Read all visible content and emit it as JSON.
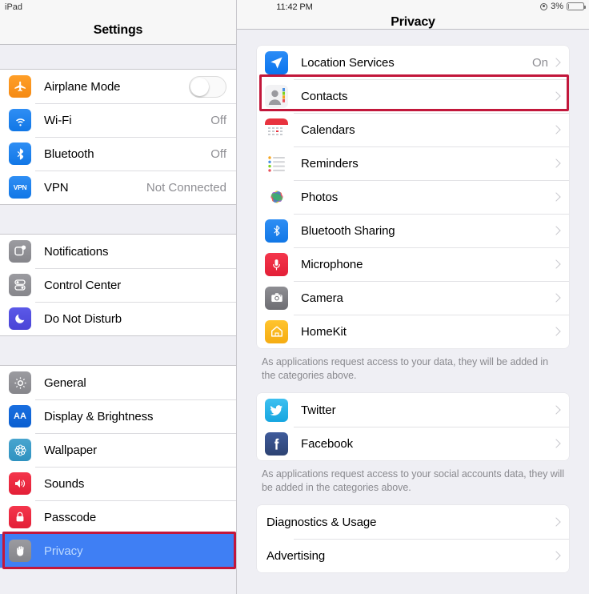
{
  "status_bar": {
    "device": "iPad",
    "time": "11:42 PM",
    "battery_percent": "3%",
    "location_icon": "location-lock-icon",
    "battery_icon": "battery-empty-icon"
  },
  "sidebar": {
    "title": "Settings",
    "groups": [
      {
        "items": [
          {
            "label": "Airplane Mode",
            "icon": "airplane-icon",
            "control": "toggle",
            "toggle_on": false,
            "value": ""
          },
          {
            "label": "Wi-Fi",
            "icon": "wifi-icon",
            "control": "value",
            "value": "Off"
          },
          {
            "label": "Bluetooth",
            "icon": "bluetooth-icon",
            "control": "value",
            "value": "Off"
          },
          {
            "label": "VPN",
            "icon": "vpn-icon",
            "control": "value",
            "value": "Not Connected"
          }
        ]
      },
      {
        "items": [
          {
            "label": "Notifications",
            "icon": "notifications-icon",
            "control": "none",
            "value": ""
          },
          {
            "label": "Control Center",
            "icon": "control-center-icon",
            "control": "none",
            "value": ""
          },
          {
            "label": "Do Not Disturb",
            "icon": "moon-icon",
            "control": "none",
            "value": ""
          }
        ]
      },
      {
        "items": [
          {
            "label": "General",
            "icon": "gear-icon",
            "control": "none",
            "value": ""
          },
          {
            "label": "Display & Brightness",
            "icon": "display-brightness-icon",
            "control": "none",
            "value": ""
          },
          {
            "label": "Wallpaper",
            "icon": "wallpaper-icon",
            "control": "none",
            "value": ""
          },
          {
            "label": "Sounds",
            "icon": "speaker-icon",
            "control": "none",
            "value": ""
          },
          {
            "label": "Passcode",
            "icon": "lock-icon",
            "control": "none",
            "value": ""
          },
          {
            "label": "Privacy",
            "icon": "hand-icon",
            "control": "none",
            "value": "",
            "selected": true
          }
        ]
      }
    ]
  },
  "detail": {
    "title": "Privacy",
    "card_one": [
      {
        "label": "Location Services",
        "icon": "location-arrow-icon",
        "value": "On",
        "highlighted": true
      },
      {
        "label": "Contacts",
        "icon": "contacts-icon",
        "value": ""
      },
      {
        "label": "Calendars",
        "icon": "calendar-icon",
        "value": ""
      },
      {
        "label": "Reminders",
        "icon": "reminders-icon",
        "value": ""
      },
      {
        "label": "Photos",
        "icon": "photos-icon",
        "value": ""
      },
      {
        "label": "Bluetooth Sharing",
        "icon": "bluetooth-icon",
        "value": ""
      },
      {
        "label": "Microphone",
        "icon": "microphone-icon",
        "value": ""
      },
      {
        "label": "Camera",
        "icon": "camera-icon",
        "value": ""
      },
      {
        "label": "HomeKit",
        "icon": "homekit-icon",
        "value": ""
      }
    ],
    "footnote_one": "As applications request access to your data, they will be added in the categories above.",
    "card_two": [
      {
        "label": "Twitter",
        "icon": "twitter-icon",
        "value": ""
      },
      {
        "label": "Facebook",
        "icon": "facebook-icon",
        "value": ""
      }
    ],
    "footnote_two": "As applications request access to your social accounts data, they will be added in the categories above.",
    "card_three": [
      {
        "label": "Diagnostics & Usage",
        "icon": "none",
        "value": ""
      },
      {
        "label": "Advertising",
        "icon": "none",
        "value": ""
      }
    ]
  },
  "annotations": {
    "accent_color": "#c2173b",
    "selection_color": "#3f7ff4",
    "boxes": [
      {
        "target": "privacy-sidebar-row"
      },
      {
        "target": "location-services-row"
      }
    ]
  }
}
